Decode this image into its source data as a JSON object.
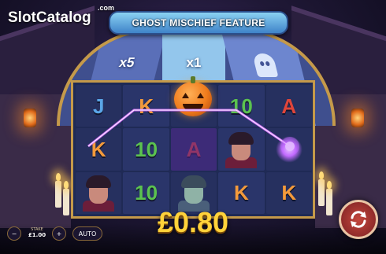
{
  "logo": {
    "text_a": "Slot",
    "text_b": "Catalog",
    "suffix": ".com"
  },
  "banner": {
    "title": "GHOST MISCHIEF FEATURE"
  },
  "multipliers": [
    "x5",
    "x1"
  ],
  "reels": [
    [
      {
        "t": "J",
        "c": "c-blue"
      },
      {
        "t": "K",
        "c": "c-orange"
      },
      {
        "t": "vampire"
      }
    ],
    [
      {
        "t": "K",
        "c": "c-orange"
      },
      {
        "t": "10",
        "c": "c-green"
      },
      {
        "t": "10",
        "c": "c-green"
      }
    ],
    [
      {
        "t": "pumpkin"
      },
      {
        "t": "A",
        "c": "c-red",
        "hl": true
      },
      {
        "t": "zombie"
      }
    ],
    [
      {
        "t": "10",
        "c": "c-green"
      },
      {
        "t": "vampire"
      },
      {
        "t": "K",
        "c": "c-orange"
      }
    ],
    [
      {
        "t": "A",
        "c": "c-red"
      },
      {
        "t": "sparkle"
      },
      {
        "t": "K",
        "c": "c-orange"
      }
    ]
  ],
  "win": {
    "amount": "£0.80"
  },
  "controls": {
    "minus": "−",
    "plus": "+",
    "stake_label": "STAKE",
    "stake_value": "£1.00",
    "auto_label": "AUTO"
  },
  "icons": {
    "spin": "spin-arrows-icon",
    "ghost": "ghost-icon",
    "pumpkin": "pumpkin-icon"
  },
  "colors": {
    "win": "#ffd23a",
    "line": "#d36bff",
    "frame": "#c59a4a"
  }
}
